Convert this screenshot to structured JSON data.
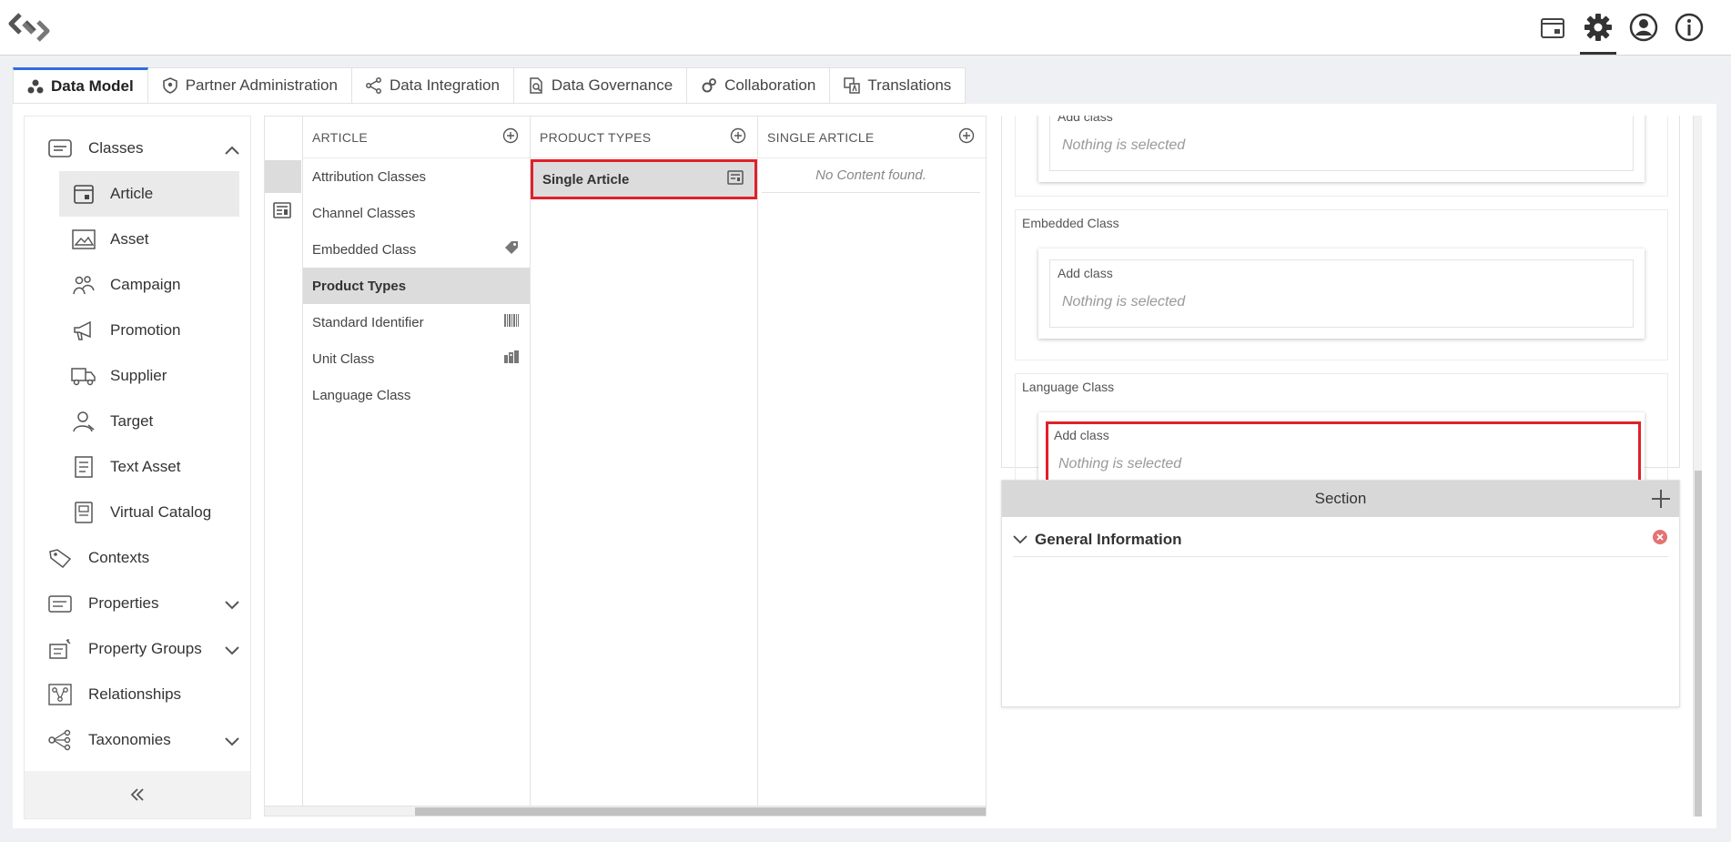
{
  "tabs": [
    {
      "label": "Data Model",
      "icon": "data-model-icon",
      "active": true
    },
    {
      "label": "Partner Administration",
      "icon": "partner-shield-icon"
    },
    {
      "label": "Data Integration",
      "icon": "share-nodes-icon"
    },
    {
      "label": "Data Governance",
      "icon": "governance-doc-icon"
    },
    {
      "label": "Collaboration",
      "icon": "gears-icon"
    },
    {
      "label": "Translations",
      "icon": "translate-icon"
    }
  ],
  "sidebar": {
    "items": [
      {
        "label": "Classes",
        "icon": "classes-icon",
        "expanded": true
      },
      {
        "label": "Article",
        "icon": "article-icon",
        "active": true
      },
      {
        "label": "Asset",
        "icon": "asset-image-icon"
      },
      {
        "label": "Campaign",
        "icon": "campaign-icon"
      },
      {
        "label": "Promotion",
        "icon": "megaphone-icon"
      },
      {
        "label": "Supplier",
        "icon": "truck-icon"
      },
      {
        "label": "Target",
        "icon": "target-user-icon"
      },
      {
        "label": "Text Asset",
        "icon": "text-asset-icon"
      },
      {
        "label": "Virtual Catalog",
        "icon": "catalog-icon"
      },
      {
        "label": "Contexts",
        "icon": "tag-icon"
      },
      {
        "label": "Properties",
        "icon": "properties-icon"
      },
      {
        "label": "Property Groups",
        "icon": "property-groups-icon"
      },
      {
        "label": "Relationships",
        "icon": "relationships-icon"
      },
      {
        "label": "Taxonomies",
        "icon": "taxonomy-icon"
      }
    ]
  },
  "columns": {
    "article": {
      "header": "ARTICLE",
      "rows": [
        "Attribution Classes",
        "Channel Classes",
        "Embedded Class",
        "Product Types",
        "Standard Identifier",
        "Unit Class",
        "Language Class"
      ]
    },
    "product_types": {
      "header": "PRODUCT TYPES",
      "rows": [
        "Single Article"
      ]
    },
    "single_article": {
      "header": "SINGLE ARTICLE",
      "empty": "No Content found."
    }
  },
  "right": {
    "groups": [
      {
        "label": "",
        "add_label": "Add class",
        "value": "Nothing is selected"
      },
      {
        "label": "Embedded Class",
        "add_label": "Add class",
        "value": "Nothing is selected"
      },
      {
        "label": "Language Class",
        "add_label": "Add class",
        "value": "Nothing is selected"
      }
    ],
    "section": {
      "title": "Section",
      "item": "General Information"
    }
  }
}
